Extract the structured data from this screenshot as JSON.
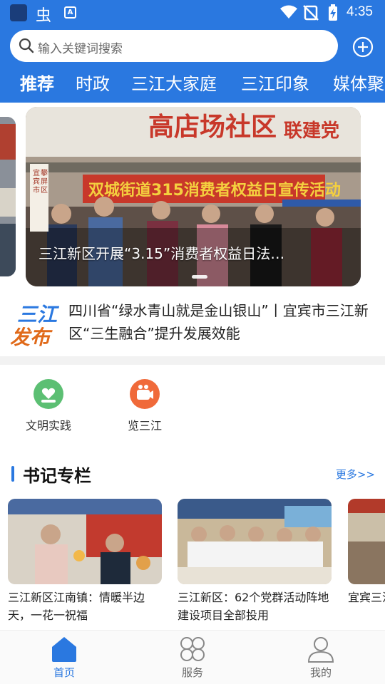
{
  "status_bar": {
    "time": "4:35",
    "app_glyph": "虫",
    "notify_glyph": "A"
  },
  "search": {
    "placeholder": "输入关键词搜索"
  },
  "tabs": [
    {
      "label": "推荐",
      "active": true
    },
    {
      "label": "时政",
      "active": false
    },
    {
      "label": "三江大家庭",
      "active": false
    },
    {
      "label": "三江印象",
      "active": false
    },
    {
      "label": "媒体聚",
      "active": false
    }
  ],
  "banner": {
    "caption": "三江新区开展“3.15”消费者权益日法…",
    "scene_sign_top": "高店场社区",
    "scene_sign_right": "联建党",
    "scene_banner": "双城街道315消费者权益日宣传活动",
    "scene_vertical_1": "宜宾市",
    "scene_vertical_2": "攀屏区"
  },
  "news": {
    "logo_line1": "三江",
    "logo_line2": "发布",
    "headline": "四川省“绿水青山就是金山银山”丨宜宾市三江新区“三生融合”提升发展效能"
  },
  "quick_links": [
    {
      "label": "文明实践",
      "icon": "heart-hand-icon",
      "color": "#5cbf73"
    },
    {
      "label": "览三江",
      "icon": "video-camera-icon",
      "color": "#f06a3a"
    }
  ],
  "section": {
    "title": "书记专栏",
    "more": "更多>>"
  },
  "cards": [
    {
      "caption": "三江新区江南镇：情暖半边天，一花一祝福"
    },
    {
      "caption": "三江新区：62个党群活动阵地建设项目全部投用"
    },
    {
      "caption": "宜宾三江责任 筑"
    }
  ],
  "bottom_nav": [
    {
      "label": "首页",
      "icon": "home-icon",
      "active": true
    },
    {
      "label": "服务",
      "icon": "services-grid-icon",
      "active": false
    },
    {
      "label": "我的",
      "icon": "profile-icon",
      "active": false
    }
  ],
  "colors": {
    "brand_blue": "#2a78e0",
    "accent_orange": "#e06a1a"
  }
}
